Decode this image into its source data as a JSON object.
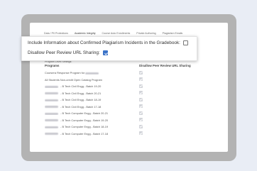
{
  "tabs": [
    "Data / PII Protections",
    "Academic Integrity",
    "Course Auto Enrollments",
    "Private Authoring",
    "Plagiarism Emails"
  ],
  "active_tab": "Academic Integrity",
  "callout": {
    "row1_label": "Include Information about Confirmed Plagiarism Incidents in the Gradebook:",
    "row1_checked": false,
    "row2_label": "Disallow Peer Review URL Sharing:",
    "row2_checked": true
  },
  "program_level_label": "Program Level Settings:",
  "table": {
    "headers": [
      "Programs",
      "Disallow Peer Review URL Sharing"
    ],
    "rows": [
      {
        "prefix": "Coursera Response Program for ",
        "blurred": true,
        "suffix": "",
        "checked": true
      },
      {
        "prefix": "All Students Non-credit Open Catalog Program",
        "blurred": false,
        "suffix": "",
        "checked": true
      },
      {
        "prefix": "",
        "blurred": true,
        "suffix": " - B Tech Civil Engg - Batch 19-20",
        "checked": true
      },
      {
        "prefix": "",
        "blurred": true,
        "suffix": " - B Tech Civil Engg - Batch 20-21",
        "checked": true
      },
      {
        "prefix": "",
        "blurred": true,
        "suffix": " - B Tech Civil Engg - Batch 18-19",
        "checked": true
      },
      {
        "prefix": "",
        "blurred": true,
        "suffix": " - B Tech Civil Engg - Batch 17-18",
        "checked": true
      },
      {
        "prefix": "",
        "blurred": true,
        "suffix": " - B Tech Computer Engg - Batch 20-21",
        "checked": true
      },
      {
        "prefix": "",
        "blurred": true,
        "suffix": " - B Tech Computer Engg - Batch 19-20",
        "checked": true
      },
      {
        "prefix": "",
        "blurred": true,
        "suffix": " - B Tech Computer Engg - Batch 18-19",
        "checked": true
      },
      {
        "prefix": "",
        "blurred": true,
        "suffix": " - B Tech Computer Engg - Batch 17-18",
        "checked": true
      }
    ]
  }
}
